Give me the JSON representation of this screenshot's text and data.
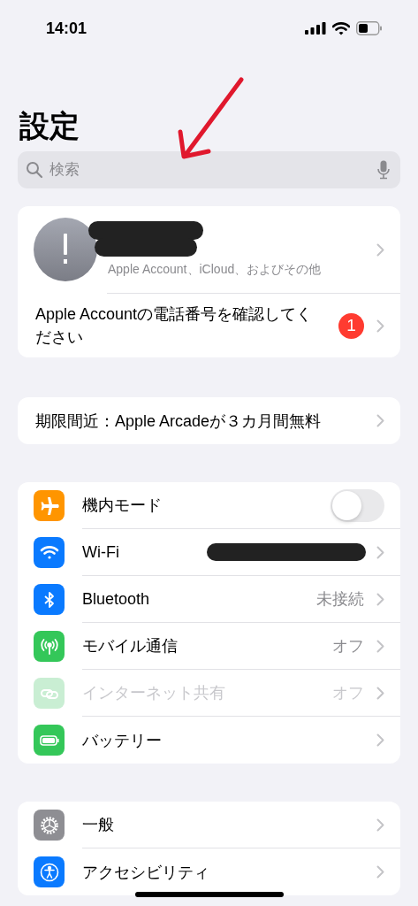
{
  "status_bar": {
    "time": "14:01"
  },
  "title": "設定",
  "search": {
    "placeholder": "検索"
  },
  "account": {
    "name_redacted": true,
    "subtitle": "Apple Account、iCloud、およびその他",
    "alert": {
      "text": "Apple Accountの電話番号を確認してください",
      "badge": "1"
    }
  },
  "offer": {
    "text": "期限間近：Apple Arcadeが３カ月間無料"
  },
  "groups": [
    {
      "items": [
        {
          "kind": "toggle",
          "color": "#ff9500",
          "label": "機内モード",
          "on": false,
          "disabled": false
        },
        {
          "kind": "link",
          "color": "#0a7aff",
          "label": "Wi-Fi",
          "value_redacted": true,
          "disabled": false
        },
        {
          "kind": "link",
          "color": "#0a7aff",
          "label": "Bluetooth",
          "value": "未接続",
          "disabled": false
        },
        {
          "kind": "link",
          "color": "#34c759",
          "label": "モバイル通信",
          "value": "オフ",
          "disabled": false
        },
        {
          "kind": "link",
          "color": "#c9eed3",
          "label": "インターネット共有",
          "value": "オフ",
          "disabled": true
        },
        {
          "kind": "link",
          "color": "#34c759",
          "label": "バッテリー",
          "disabled": false
        }
      ]
    },
    {
      "items": [
        {
          "kind": "link",
          "color": "#8e8e93",
          "label": "一般",
          "disabled": false
        },
        {
          "kind": "link",
          "color": "#0a7aff",
          "label": "アクセシビリティ",
          "disabled": false
        }
      ]
    }
  ]
}
